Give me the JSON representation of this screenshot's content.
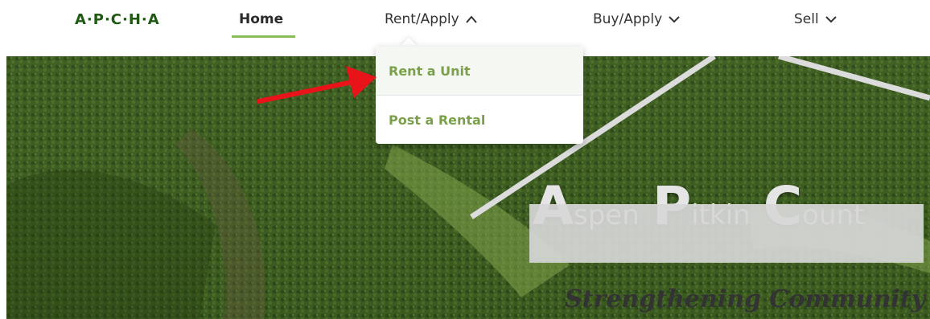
{
  "nav": {
    "logo": "A·P·C·H·A",
    "home": "Home",
    "rent_apply": "Rent/Apply",
    "buy_apply": "Buy/Apply",
    "sell": "Sell"
  },
  "dropdown": {
    "items": [
      {
        "label": "Rent a Unit"
      },
      {
        "label": "Post a Rental"
      }
    ]
  },
  "hero": {
    "title_parts": [
      "A",
      "spen",
      "P",
      "itkin",
      "C",
      "ount"
    ],
    "tagline": "Strengthening Community Th"
  },
  "icons": {
    "rent_chevron": "chevron-up-icon",
    "buy_chevron": "chevron-down-icon",
    "sell_chevron": "chevron-down-icon"
  },
  "colors": {
    "logo": "#1f5a12",
    "accent": "#8bbb59",
    "dropdown_text": "#7aa14a",
    "annotation_arrow": "#e8141a"
  }
}
